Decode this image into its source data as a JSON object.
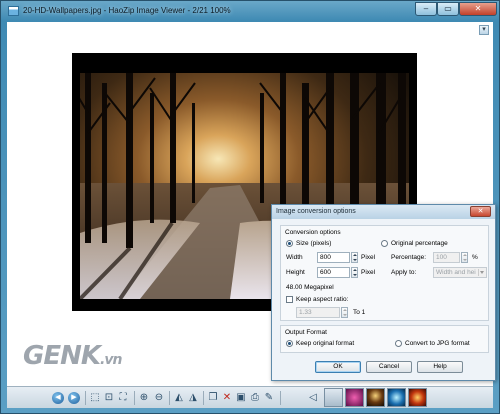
{
  "window": {
    "title": "20-HD-Wallpapers.jpg - HaoZip Image Viewer - 2/21 100%",
    "caption_buttons": {
      "minimize": "–",
      "maximize": "▭",
      "close": "✕"
    }
  },
  "watermark": {
    "brand": "GENK",
    "suffix": ".vn"
  },
  "dialog": {
    "title": "Image conversion options",
    "close_label": "✕",
    "conversion_options": {
      "heading": "Conversion options",
      "size_pixels_label": "Size (pixels)",
      "size_pixels_selected": true,
      "original_percentage_label": "Original percentage",
      "original_percentage_selected": false,
      "width_label": "Width",
      "width_value": "800",
      "width_unit": "Pixel",
      "height_label": "Height",
      "height_value": "600",
      "height_unit": "Pixel",
      "megapixel": "48.00 Megapixel",
      "percentage_label": "Percentage:",
      "percentage_value": "100",
      "percentage_unit": "%",
      "apply_to_label": "Apply to:",
      "apply_to_value": "Width and hei",
      "keep_aspect_label": "Keep aspect ratio:",
      "keep_aspect_checked": false,
      "ratio_value": "1.33",
      "ratio_suffix": "To 1"
    },
    "output_format": {
      "heading": "Output Format",
      "keep_original_label": "Keep original format",
      "keep_original_selected": true,
      "convert_jpg_label": "Convert to JPG format",
      "convert_jpg_selected": false
    },
    "buttons": {
      "ok": "OK",
      "cancel": "Cancel",
      "help": "Help"
    }
  },
  "client": {
    "corner_icon": "▾"
  },
  "toolbar": {
    "icons": [
      "previous-icon",
      "next-icon",
      "fit-window-icon",
      "actual-size-icon",
      "fullscreen-icon",
      "zoom-in-icon",
      "zoom-out-icon",
      "rotate-left-icon",
      "rotate-right-icon",
      "copy-icon",
      "delete-icon",
      "slideshow-icon",
      "print-icon",
      "settings-icon",
      "scroll-left-icon"
    ],
    "glyphs": {
      "prev": "◀",
      "next": "▶",
      "fit": "⬚",
      "actual": "⊡",
      "fullscreen": "⛶",
      "zoom_in": "⊕",
      "zoom_out": "⊖",
      "rotate_left": "◭",
      "rotate_right": "◮",
      "copy": "❐",
      "delete": "✕",
      "slideshow": "▣",
      "print": "⎙",
      "settings": "✎",
      "scroll_left": "◁"
    }
  },
  "colors": {
    "title_bar": "#5b9fc4",
    "dialog_bg": "#eef3f8",
    "delete_red": "#c0281c"
  }
}
